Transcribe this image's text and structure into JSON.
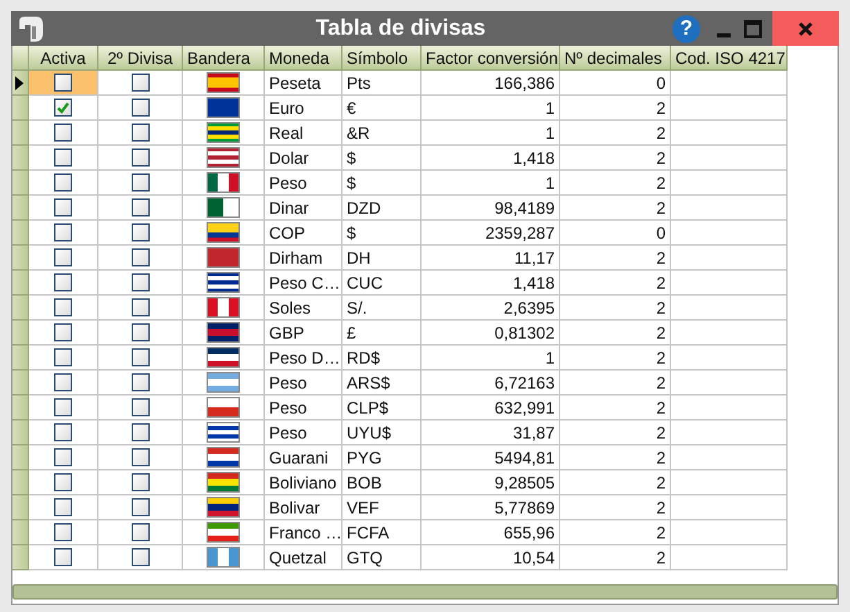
{
  "window": {
    "title": "Tabla de divisas",
    "help": "?"
  },
  "table": {
    "columns": [
      "Activa",
      "2º Divisa",
      "Bandera",
      "Moneda",
      "Símbolo",
      "Factor conversión",
      "Nº decimales",
      "Cod. ISO 4217"
    ],
    "rows": [
      {
        "selected": true,
        "activa": false,
        "segunda": false,
        "moneda": "Peseta",
        "simbolo": "Pts",
        "factor": "166,386",
        "decimales": "0"
      },
      {
        "selected": false,
        "activa": true,
        "segunda": false,
        "moneda": "Euro",
        "simbolo": "€",
        "factor": "1",
        "decimales": "2"
      },
      {
        "selected": false,
        "activa": false,
        "segunda": false,
        "moneda": "Real",
        "simbolo": "&R",
        "factor": "1",
        "decimales": "2"
      },
      {
        "selected": false,
        "activa": false,
        "segunda": false,
        "moneda": "Dolar",
        "simbolo": "$",
        "factor": "1,418",
        "decimales": "2"
      },
      {
        "selected": false,
        "activa": false,
        "segunda": false,
        "moneda": "Peso",
        "simbolo": "$",
        "factor": "1",
        "decimales": "2"
      },
      {
        "selected": false,
        "activa": false,
        "segunda": false,
        "moneda": "Dinar",
        "simbolo": "DZD",
        "factor": "98,4189",
        "decimales": "2"
      },
      {
        "selected": false,
        "activa": false,
        "segunda": false,
        "moneda": "COP",
        "simbolo": "$",
        "factor": "2359,287",
        "decimales": "0"
      },
      {
        "selected": false,
        "activa": false,
        "segunda": false,
        "moneda": "Dirham",
        "simbolo": "DH",
        "factor": "11,17",
        "decimales": "2"
      },
      {
        "selected": false,
        "activa": false,
        "segunda": false,
        "moneda": "Peso C…",
        "simbolo": "CUC",
        "factor": "1,418",
        "decimales": "2"
      },
      {
        "selected": false,
        "activa": false,
        "segunda": false,
        "moneda": "Soles",
        "simbolo": "S/.",
        "factor": "2,6395",
        "decimales": "2"
      },
      {
        "selected": false,
        "activa": false,
        "segunda": false,
        "moneda": "GBP",
        "simbolo": "£",
        "factor": "0,81302",
        "decimales": "2"
      },
      {
        "selected": false,
        "activa": false,
        "segunda": false,
        "moneda": "Peso D…",
        "simbolo": "RD$",
        "factor": "1",
        "decimales": "2"
      },
      {
        "selected": false,
        "activa": false,
        "segunda": false,
        "moneda": "Peso",
        "simbolo": "ARS$",
        "factor": "6,72163",
        "decimales": "2"
      },
      {
        "selected": false,
        "activa": false,
        "segunda": false,
        "moneda": "Peso",
        "simbolo": "CLP$",
        "factor": "632,991",
        "decimales": "2"
      },
      {
        "selected": false,
        "activa": false,
        "segunda": false,
        "moneda": "Peso",
        "simbolo": "UYU$",
        "factor": "31,87",
        "decimales": "2"
      },
      {
        "selected": false,
        "activa": false,
        "segunda": false,
        "moneda": "Guarani",
        "simbolo": "PYG",
        "factor": "5494,81",
        "decimales": "2"
      },
      {
        "selected": false,
        "activa": false,
        "segunda": false,
        "moneda": "Boliviano",
        "simbolo": "BOB",
        "factor": "9,28505",
        "decimales": "2"
      },
      {
        "selected": false,
        "activa": false,
        "segunda": false,
        "moneda": "Bolivar",
        "simbolo": "VEF",
        "factor": "5,77869",
        "decimales": "2"
      },
      {
        "selected": false,
        "activa": false,
        "segunda": false,
        "moneda": "Franco …",
        "simbolo": "FCFA",
        "factor": "655,96",
        "decimales": "2"
      },
      {
        "selected": false,
        "activa": false,
        "segunda": false,
        "moneda": "Quetzal",
        "simbolo": "GTQ",
        "factor": "10,54",
        "decimales": "2"
      }
    ]
  }
}
